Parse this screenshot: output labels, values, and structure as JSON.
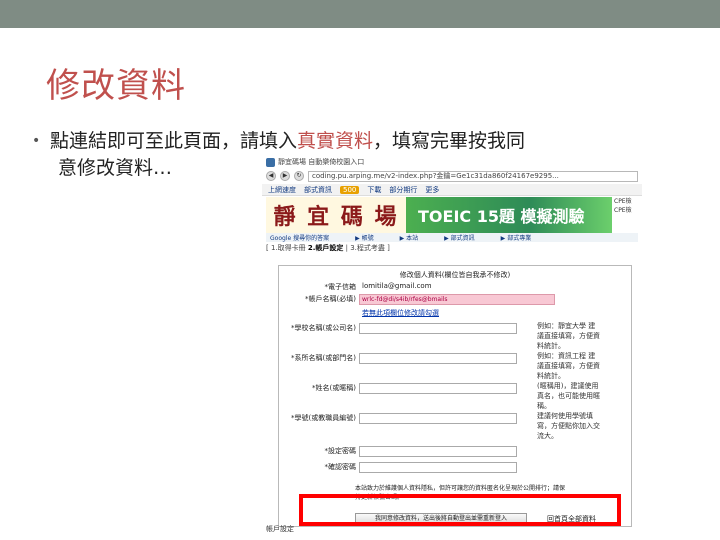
{
  "slide": {
    "title": "修改資料",
    "bullet_before": "點連結即可至此頁面，請填入",
    "bullet_highlight": "真實資料",
    "bullet_after": "，填寫完畢按我同",
    "bullet_line2": "意修改資料…",
    "colors": {
      "title": "#c0504d",
      "band": "#7f8c84",
      "highlight_frame": "#ff0000"
    }
  },
  "browser": {
    "tab_title": "靜宜碼場 自動樂倚校園入口",
    "url": "coding.pu.arping.me/v2-index.php?金鑰=Ge1c31da860f24167e9295...",
    "bookmarks": [
      "上網速度",
      "部式資訊",
      "500",
      "下載",
      "部分期行",
      "更多"
    ],
    "bookmark_badge": "500"
  },
  "banner": {
    "logo_text": "靜 宜 碼 場",
    "toeic_text": "TOEIC 15題 模擬測驗",
    "side_text": "CPE檢 CPE檢"
  },
  "subnav": [
    "Google 搜尋你的答案",
    "▶ 帳號",
    "▶ 本站",
    "▶ 部式資訊",
    "▶ 部式專業"
  ],
  "steps": {
    "prefix": "[ 1.取得卡冊",
    "current": "2.帳戶設定",
    "suffix": "| 3.程式考盡 ]"
  },
  "form": {
    "title": "修改個人資料(欄位皆自我承不修改)",
    "rows": [
      {
        "label": "*電子信箱",
        "value": "lomitila@gmail.com"
      },
      {
        "label": "*帳戶名稱(必填)",
        "value": "wrlc-fd@di/s4ib/rfes@bmails"
      },
      {
        "label": "",
        "value": "若無此項欄位修改請勾選"
      },
      {
        "label": "*學校名稱(或公司名)",
        "value": ""
      },
      {
        "label": "*系所名稱(或部門名)",
        "value": ""
      },
      {
        "label": "*姓名(或暱稱)",
        "value": ""
      },
      {
        "label": "*學號(或教職員編號)",
        "value": ""
      },
      {
        "label": "*設定密碼",
        "value": ""
      },
      {
        "label": "*確認密碼",
        "value": ""
      }
    ],
    "hints": [
      "例如：靜宜大學 建議直接填寫，方便資料統計。",
      "例如：資訊工程 建議直接填寫，方便資料統計。",
      "(暱稱用)，建議使用真名，也可能使用暱稱。",
      "建議何使用學號填寫，方便點你加入交流大。"
    ],
    "notice": "本站致力於維護個人資料隱私，但許可讓您的資料匿名化呈現於公開排行；請保持更新帳號密碼。",
    "submit_label": "我同意修改資料，送出後將自動登出並需重新登入",
    "back_label": "回首頁全部資料"
  },
  "bottom_note": "帳戶設定"
}
